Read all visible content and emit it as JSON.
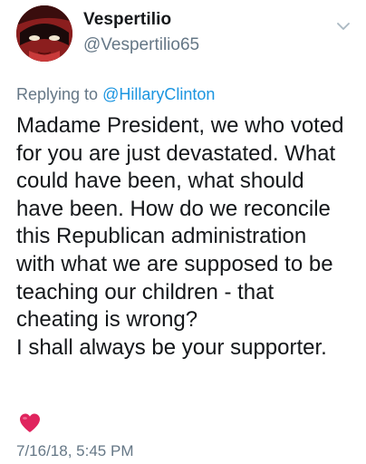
{
  "user": {
    "display_name": "Vespertilio",
    "handle": "@Vespertilio65",
    "avatar_icon": "avatar-image"
  },
  "reply": {
    "prefix": "Replying to ",
    "mention": "@HillaryClinton"
  },
  "tweet": {
    "text": "Madame President, we who voted\nfor you are just devastated. What\ncould have been, what should\nhave been. How do we reconcile\nthis Republican administration\nwith what we are supposed to be\nteaching our children - that\ncheating is wrong?\nI shall always be your supporter.",
    "emoji": "heart-icon",
    "timestamp": "7/16/18, 5:45 PM"
  },
  "colors": {
    "text": "#14171a",
    "secondary": "#657786",
    "link": "#1b95e0",
    "heart": "#e0245e"
  }
}
